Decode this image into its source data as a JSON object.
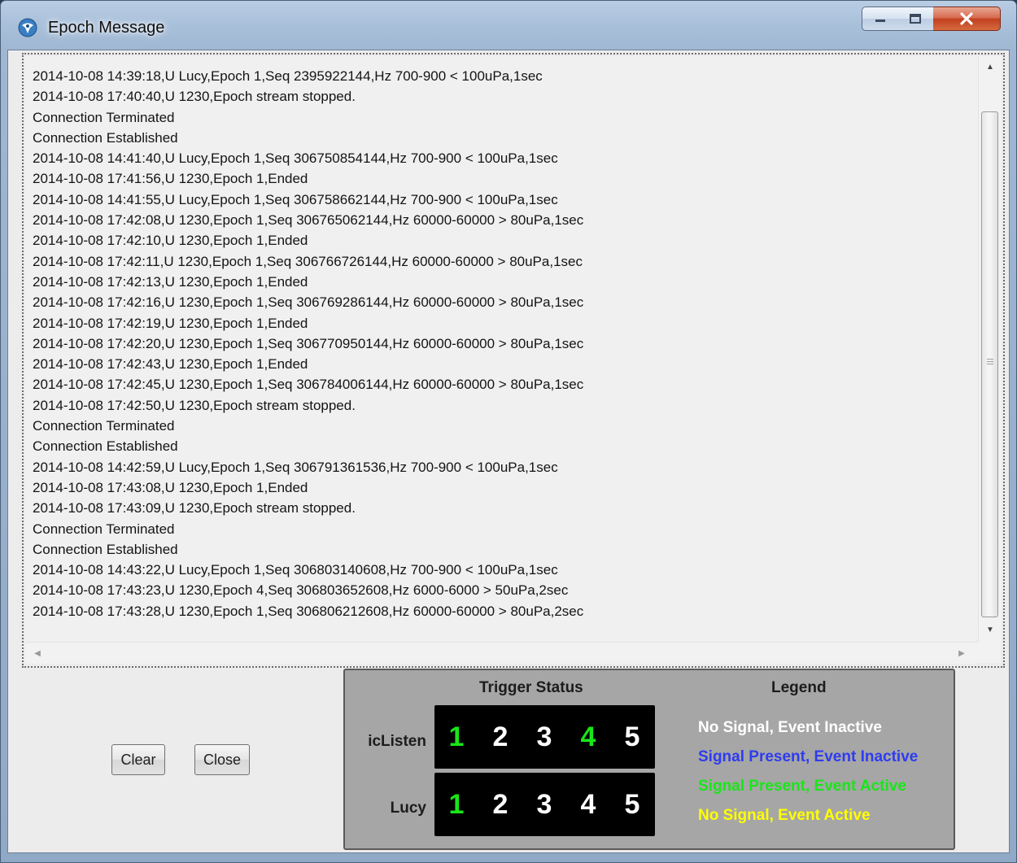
{
  "window": {
    "title": "Epoch Message",
    "app_icon": "satellite-dish-icon",
    "controls": {
      "minimize_icon": "minimize-icon",
      "maximize_icon": "maximize-icon",
      "close_icon": "close-icon"
    }
  },
  "log": {
    "lines": [
      "2014-10-08 14:39:18,U Lucy,Epoch 1,Seq 2395922144,Hz 700-900 < 100uPa,1sec",
      "2014-10-08 17:40:40,U 1230,Epoch stream stopped.",
      "Connection Terminated",
      "Connection Established",
      "2014-10-08 14:41:40,U Lucy,Epoch 1,Seq 306750854144,Hz 700-900 < 100uPa,1sec",
      "2014-10-08 17:41:56,U 1230,Epoch 1,Ended",
      "2014-10-08 14:41:55,U Lucy,Epoch 1,Seq 306758662144,Hz 700-900 < 100uPa,1sec",
      "2014-10-08 17:42:08,U 1230,Epoch 1,Seq 306765062144,Hz 60000-60000 > 80uPa,1sec",
      "2014-10-08 17:42:10,U 1230,Epoch 1,Ended",
      "2014-10-08 17:42:11,U 1230,Epoch 1,Seq 306766726144,Hz 60000-60000 > 80uPa,1sec",
      "2014-10-08 17:42:13,U 1230,Epoch 1,Ended",
      "2014-10-08 17:42:16,U 1230,Epoch 1,Seq 306769286144,Hz 60000-60000 > 80uPa,1sec",
      "2014-10-08 17:42:19,U 1230,Epoch 1,Ended",
      "2014-10-08 17:42:20,U 1230,Epoch 1,Seq 306770950144,Hz 60000-60000 > 80uPa,1sec",
      "2014-10-08 17:42:43,U 1230,Epoch 1,Ended",
      "2014-10-08 17:42:45,U 1230,Epoch 1,Seq 306784006144,Hz 60000-60000 > 80uPa,1sec",
      "2014-10-08 17:42:50,U 1230,Epoch stream stopped.",
      "Connection Terminated",
      "Connection Established",
      "2014-10-08 14:42:59,U Lucy,Epoch 1,Seq 306791361536,Hz 700-900 < 100uPa,1sec",
      "2014-10-08 17:43:08,U 1230,Epoch 1,Ended",
      "2014-10-08 17:43:09,U 1230,Epoch stream stopped.",
      "Connection Terminated",
      "Connection Established",
      "2014-10-08 14:43:22,U Lucy,Epoch 1,Seq 306803140608,Hz 700-900 < 100uPa,1sec",
      "2014-10-08 17:43:23,U 1230,Epoch 4,Seq 306803652608,Hz 6000-6000 > 50uPa,2sec",
      "2014-10-08 17:43:28,U 1230,Epoch 1,Seq 306806212608,Hz 60000-60000 > 80uPa,2sec"
    ],
    "scroll_icons": [
      "scroll-up-icon",
      "scroll-down-icon",
      "scroll-left-icon",
      "scroll-right-icon"
    ]
  },
  "buttons": {
    "clear": "Clear",
    "close": "Close"
  },
  "trigger_status": {
    "heading": "Trigger Status",
    "rows": [
      {
        "label": "icListen",
        "digits": [
          {
            "text": "1",
            "color": "#19e619"
          },
          {
            "text": "2",
            "color": "#ffffff"
          },
          {
            "text": "3",
            "color": "#ffffff"
          },
          {
            "text": "4",
            "color": "#19e619"
          },
          {
            "text": "5",
            "color": "#ffffff"
          }
        ]
      },
      {
        "label": "Lucy",
        "digits": [
          {
            "text": "1",
            "color": "#19e619"
          },
          {
            "text": "2",
            "color": "#ffffff"
          },
          {
            "text": "3",
            "color": "#ffffff"
          },
          {
            "text": "4",
            "color": "#ffffff"
          },
          {
            "text": "5",
            "color": "#ffffff"
          }
        ]
      }
    ]
  },
  "legend": {
    "heading": "Legend",
    "items": [
      {
        "text": "No Signal, Event Inactive",
        "color": "#ffffff"
      },
      {
        "text": "Signal Present, Event Inactive",
        "color": "#2e3cf0"
      },
      {
        "text": "Signal Present, Event Active",
        "color": "#19e619"
      },
      {
        "text": "No Signal, Event Active",
        "color": "#ffff00"
      }
    ]
  }
}
